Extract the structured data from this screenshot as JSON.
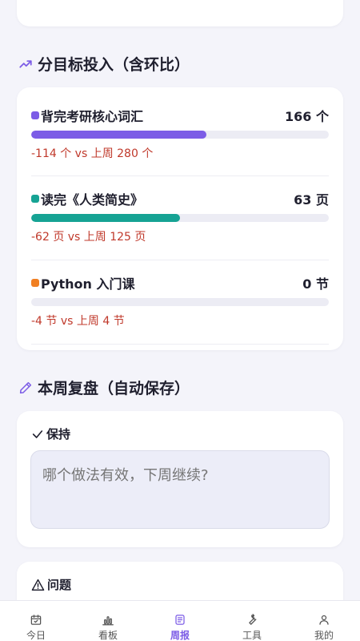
{
  "goals_section": {
    "title": "分目标投入（含环比）",
    "items": [
      {
        "name": "背完考研核心词汇",
        "value": "166 个",
        "delta": "-114 个 vs 上周 280 个",
        "progress": 0.59,
        "color": "#7c5ce6"
      },
      {
        "name": "读完《人类简史》",
        "value": "63 页",
        "delta": "-62 页 vs 上周 125 页",
        "progress": 0.5,
        "color": "#16a394"
      },
      {
        "name": "Python 入门课",
        "value": "0 节",
        "delta": "-4 节 vs 上周 4 节",
        "progress": 0,
        "color": "#f07f22"
      }
    ]
  },
  "review_section": {
    "title": "本周复盘（自动保存）",
    "keep": {
      "label": "保持",
      "placeholder": "哪个做法有效，下周继续?"
    },
    "problem": {
      "label": "问题"
    }
  },
  "bottom_nav": {
    "items": [
      {
        "label": "今日",
        "icon": "calendar-icon",
        "active": false
      },
      {
        "label": "看板",
        "icon": "bar-chart-icon",
        "active": false
      },
      {
        "label": "周报",
        "icon": "report-icon",
        "active": true
      },
      {
        "label": "工具",
        "icon": "wrench-icon",
        "active": false
      },
      {
        "label": "我的",
        "icon": "user-icon",
        "active": false
      }
    ],
    "active_color": "#7c5ce6"
  }
}
